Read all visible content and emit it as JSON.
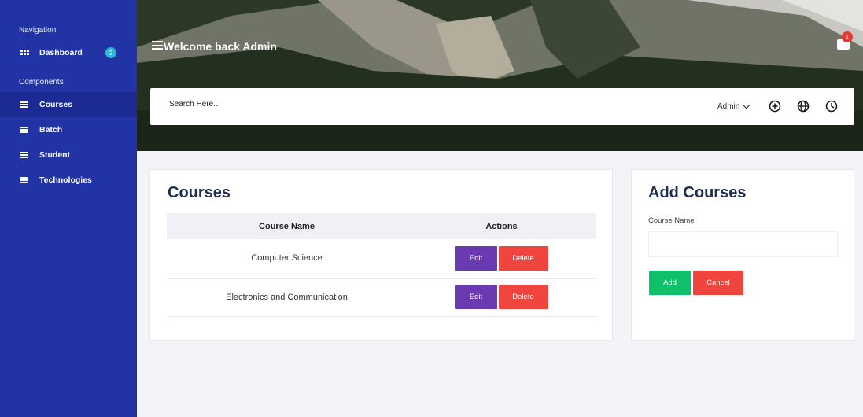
{
  "sidebar": {
    "nav_heading": "Navigation",
    "dashboard": {
      "label": "Dashboard",
      "badge": "2",
      "icon": "dashboard-grid-icon"
    },
    "components_heading": "Components",
    "items": [
      {
        "label": "Courses",
        "icon": "list-icon",
        "active": true
      },
      {
        "label": "Batch",
        "icon": "list-icon",
        "active": false
      },
      {
        "label": "Student",
        "icon": "list-icon",
        "active": false
      },
      {
        "label": "Technologies",
        "icon": "list-icon",
        "active": false
      }
    ]
  },
  "header": {
    "welcome": "Welcome back Admin",
    "notification_count": "1",
    "search_placeholder": "Search Here...",
    "user_menu": "Admin",
    "icons": [
      "plus-circle-icon",
      "globe-icon",
      "clock-icon"
    ]
  },
  "courses": {
    "title": "Courses",
    "columns": [
      "Course Name",
      "Actions"
    ],
    "rows": [
      {
        "name": "Computer Science",
        "edit": "Edit",
        "delete": "Delete"
      },
      {
        "name": "Electronics and Communication",
        "edit": "Edit",
        "delete": "Delete"
      }
    ]
  },
  "add_course": {
    "title": "Add Courses",
    "field_label": "Course Name",
    "field_value": "",
    "add_label": "Add",
    "cancel_label": "Cancel"
  },
  "colors": {
    "sidebar": "#2233a6",
    "edit": "#6a3ab0",
    "delete": "#f0443e",
    "add": "#0fbf6a",
    "badge": "#2bb8d6"
  }
}
